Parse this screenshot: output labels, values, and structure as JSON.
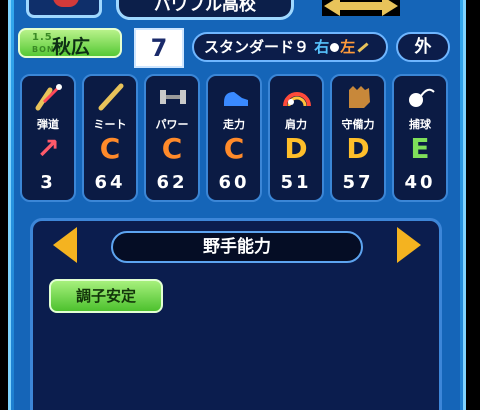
{
  "header": {
    "school_name": "パワフル高校"
  },
  "profile": {
    "bonus_label": "1.5",
    "bonus_sub": "BONUS",
    "player_name": "秋広",
    "number": "7",
    "form_label": "スタンダード９",
    "throw_hand": "右",
    "bat_hand": "左",
    "position": "外"
  },
  "stats": [
    {
      "label": "弾道",
      "grade": "↗",
      "value": "3",
      "grade_color": "#ff5a6a",
      "icon": "trajectory-icon"
    },
    {
      "label": "ミート",
      "grade": "C",
      "value": "64",
      "grade_color": "#ff8a2a",
      "icon": "bat-icon"
    },
    {
      "label": "パワー",
      "grade": "C",
      "value": "62",
      "grade_color": "#ff8a2a",
      "icon": "dumbbell-icon"
    },
    {
      "label": "走力",
      "grade": "C",
      "value": "60",
      "grade_color": "#ff8a2a",
      "icon": "shoe-icon"
    },
    {
      "label": "肩力",
      "grade": "D",
      "value": "51",
      "grade_color": "#ffbf2a",
      "icon": "rainbow-icon"
    },
    {
      "label": "守備力",
      "grade": "D",
      "value": "57",
      "grade_color": "#ffbf2a",
      "icon": "glove-icon"
    },
    {
      "label": "捕球",
      "grade": "E",
      "value": "40",
      "grade_color": "#7fe05a",
      "icon": "ball-icon"
    }
  ],
  "abilities": {
    "title": "野手能力",
    "items": [
      "調子安定"
    ]
  }
}
